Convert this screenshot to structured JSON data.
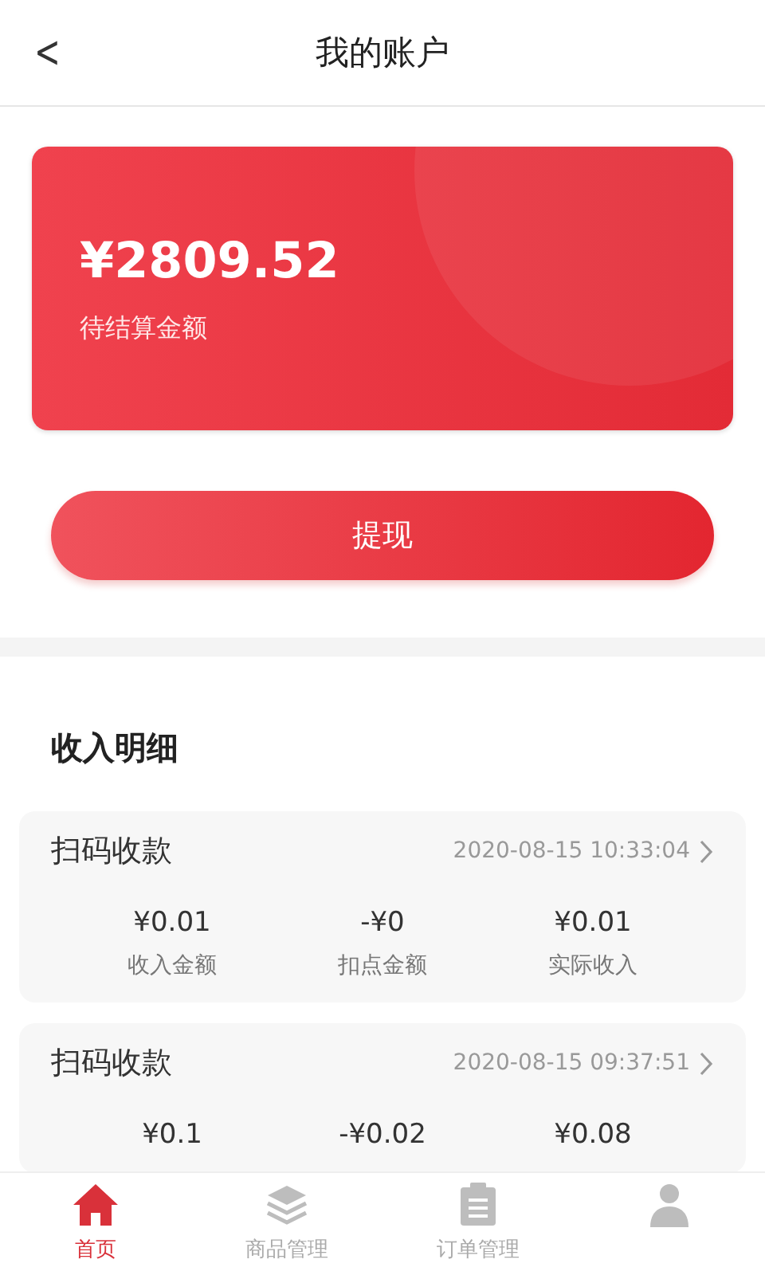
{
  "header": {
    "back": "<",
    "title": "我的账户"
  },
  "balance": {
    "amount": "¥2809.52",
    "label": "待结算金额"
  },
  "withdraw_button": "提现",
  "section_title": "收入明细",
  "records": [
    {
      "type": "扫码收款",
      "time": "2020-08-15 10:33:04",
      "columns": [
        {
          "value": "¥0.01",
          "label": "收入金额"
        },
        {
          "value": "-¥0",
          "label": "扣点金额"
        },
        {
          "value": "¥0.01",
          "label": "实际收入"
        }
      ]
    },
    {
      "type": "扫码收款",
      "time": "2020-08-15 09:37:51",
      "columns": [
        {
          "value": "¥0.1"
        },
        {
          "value": "-¥0.02"
        },
        {
          "value": "¥0.08"
        }
      ]
    }
  ],
  "tabs": [
    {
      "kind": "home",
      "label": "首页",
      "selected": true
    },
    {
      "kind": "layers",
      "label": "商品管理",
      "selected": false
    },
    {
      "kind": "clipboard",
      "label": "订单管理",
      "selected": false
    },
    {
      "kind": "person",
      "selected": false
    }
  ]
}
